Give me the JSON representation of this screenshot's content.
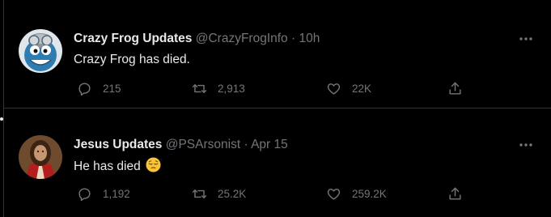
{
  "colors": {
    "background": "#000000",
    "text_primary": "#e7e9ea",
    "text_secondary": "#71767b",
    "divider": "#2f3336"
  },
  "tweets": [
    {
      "display_name": "Crazy Frog Updates",
      "handle": "@CrazyFrogInfo",
      "separator": "·",
      "time": "10h",
      "text": "Crazy Frog has died.",
      "avatar_icon": "crazy-frog-avatar",
      "replies": "215",
      "retweets": "2,913",
      "likes": "22K"
    },
    {
      "display_name": "Jesus Updates",
      "handle": "@PSArsonist",
      "separator": "·",
      "time": "Apr 15",
      "text": "He has died",
      "emoji": "pensive-face-emoji",
      "avatar_icon": "jesus-portrait-avatar",
      "replies": "1,192",
      "retweets": "25.2K",
      "likes": "259.2K"
    }
  ],
  "icons": {
    "reply": "reply-icon",
    "retweet": "retweet-icon",
    "like": "heart-icon",
    "share": "share-icon",
    "more": "more-options-icon"
  }
}
